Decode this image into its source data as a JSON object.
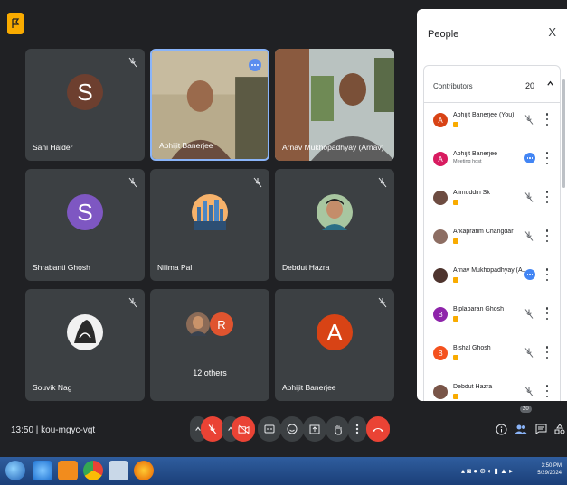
{
  "tiles": [
    {
      "name": "Sani Halder",
      "initial": "S",
      "color": "#6d3f2f"
    },
    {
      "name": "Abhijit Banerjee"
    },
    {
      "name": "Arnav Mukhopadhyay (Arnav)"
    },
    {
      "name": "Shrabanti Ghosh",
      "initial": "S",
      "color": "#7e57c2"
    },
    {
      "name": "Nilima Pal"
    },
    {
      "name": "Debdut Hazra"
    },
    {
      "name": "Souvik Nag"
    },
    {
      "name": "12 others",
      "initial": "R",
      "color": "#e0542f"
    },
    {
      "name": "Abhijit Banerjee",
      "initial": "A",
      "color": "#d84315"
    }
  ],
  "panel": {
    "title": "People",
    "close": "X",
    "contributors_label": "Contributors",
    "contributors_count": "20",
    "people": [
      {
        "name": "Abhijit Banerjee (You)",
        "initial": "A",
        "color": "#d84315",
        "sub": "",
        "state": "muted"
      },
      {
        "name": "Abhijit Banerjee",
        "initial": "A",
        "color": "#d81b60",
        "sub": "Meeting host",
        "state": "speaking"
      },
      {
        "name": "Alimuddin Sk",
        "initial": "",
        "color": "#6d4c41",
        "sub": "",
        "state": "muted"
      },
      {
        "name": "Arkapratim Changdar",
        "initial": "",
        "color": "#8d6e63",
        "sub": "",
        "state": "muted"
      },
      {
        "name": "Arnav Mukhopadhyay (A...",
        "initial": "",
        "color": "#4e342e",
        "sub": "",
        "state": "speaking"
      },
      {
        "name": "Biplabaran Ghosh",
        "initial": "B",
        "color": "#8e24aa",
        "sub": "",
        "state": "muted"
      },
      {
        "name": "Bishal Ghosh",
        "initial": "B",
        "color": "#f4511e",
        "sub": "",
        "state": "muted"
      },
      {
        "name": "Debdut Hazra",
        "initial": "",
        "color": "#795548",
        "sub": "",
        "state": "muted"
      }
    ]
  },
  "bottom": {
    "meeting_time": "13:50 | kou-mgyc-vgt",
    "people_count": "20"
  },
  "taskbar": {
    "time": "3:50 PM",
    "date": "5/29/2024"
  },
  "colors": {
    "bg": "#202124",
    "tile": "#3c4043",
    "accent_red": "#ea4335",
    "highlight": "#8ab4f8"
  }
}
